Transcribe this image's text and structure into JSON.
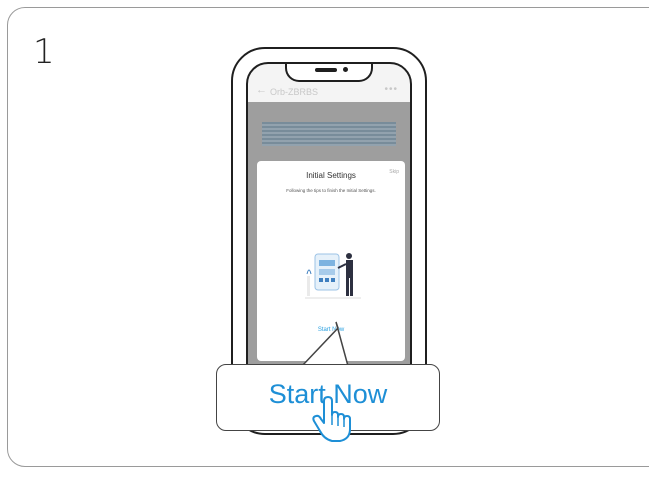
{
  "step": {
    "number": "1"
  },
  "app": {
    "header": {
      "device_name": "Orb-ZBRBS",
      "back_icon": "arrow-left-icon",
      "more_icon": "more-icon"
    },
    "modal": {
      "title": "Initial Settings",
      "skip_label": "Skip",
      "tip": "Following the tips to finish the Initial Settings.",
      "start_label": "Start Now"
    }
  },
  "callout": {
    "label": "Start Now",
    "icon": "hand-pointer-icon"
  },
  "colors": {
    "accent": "#1e8fd6",
    "overlay": "#9e9e9e"
  }
}
